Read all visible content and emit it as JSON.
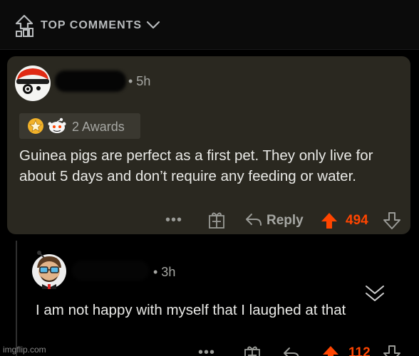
{
  "header": {
    "sort_label": "TOP COMMENTS",
    "sort_icon": "top-sort-icon",
    "chevron_icon": "chevron-down-icon"
  },
  "comments": [
    {
      "time": "• 5h",
      "awards_label": "2 Awards",
      "body": "Guinea pigs are perfect as a first pet. They only live for about 5 days and don’t require any feeding or water.",
      "more_label": "•••",
      "reply_label": "Reply",
      "score": "494"
    },
    {
      "time": "• 3h",
      "body": "I am not happy with myself that I laughed at that",
      "more_label": "•••",
      "score": "112"
    }
  ],
  "watermark": "imgflip.com",
  "colors": {
    "accent": "#ff4500",
    "card_bg": "#2a2820",
    "page_bg": "#000000"
  }
}
